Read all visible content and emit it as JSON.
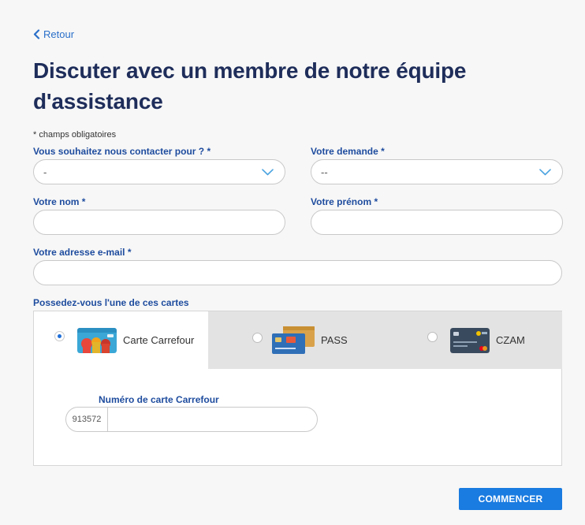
{
  "back_link": {
    "label": "Retour",
    "icon": "chevron-left-icon"
  },
  "title": "Discuter avec un membre de notre équipe d'assistance",
  "required_note": "* champs obligatoires",
  "form": {
    "contact_reason": {
      "label": "Vous souhaitez nous contacter pour ? *",
      "value": "-"
    },
    "request": {
      "label": "Votre demande *",
      "value": "--"
    },
    "last_name": {
      "label": "Votre nom *",
      "value": ""
    },
    "first_name": {
      "label": "Votre prénom *",
      "value": ""
    },
    "email": {
      "label": "Votre adresse e-mail *",
      "value": ""
    }
  },
  "cards_section": {
    "label": "Possedez-vous l'une de ces cartes",
    "options": [
      {
        "label": "Carte Carrefour",
        "selected": true
      },
      {
        "label": "PASS",
        "selected": false
      },
      {
        "label": "CZAM",
        "selected": false
      }
    ],
    "card_number": {
      "label": "Numéro de carte Carrefour",
      "prefix": "913572",
      "value": ""
    }
  },
  "submit_label": "COMMENCER",
  "colors": {
    "title": "#1e2d5a",
    "label": "#1e4c9e",
    "link": "#2a6fc9",
    "button": "#1a7be0",
    "radio_selected": "#1f6fd8"
  }
}
